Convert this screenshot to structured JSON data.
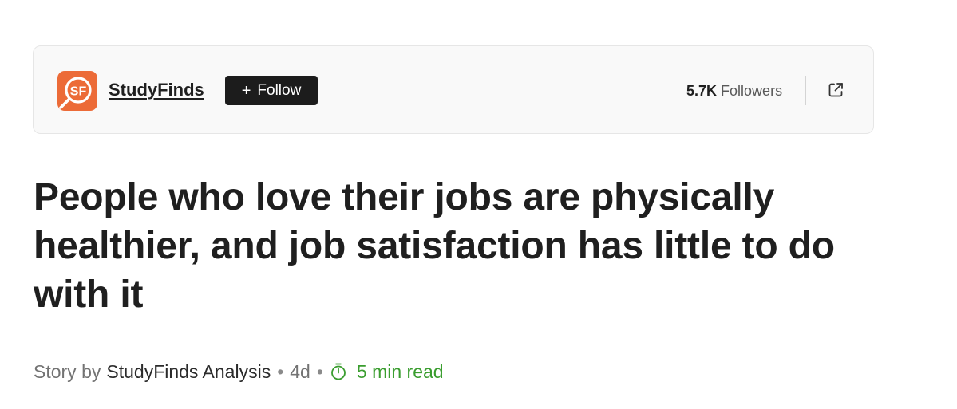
{
  "publisher": {
    "logo_text": "SF",
    "logo_icon": "studyfinds-logo-icon",
    "name": "StudyFinds",
    "follow_icon": "+",
    "follow_label": "Follow",
    "followers_count": "5.7K",
    "followers_label": "Followers",
    "external_icon": "external-link-icon"
  },
  "article": {
    "headline": "People who love their jobs are physically healthier, and job satisfaction has little to do with it"
  },
  "byline": {
    "prefix": "Story by",
    "author": "StudyFinds Analysis",
    "separator": "•",
    "age": "4d",
    "timer_icon": "timer-icon",
    "read_time": "5 min read"
  },
  "colors": {
    "logo_bg": "#ec6b38",
    "follow_bg": "#1c1c1c",
    "read_time": "#3a9d2f",
    "card_bg": "#f9f9f9"
  }
}
